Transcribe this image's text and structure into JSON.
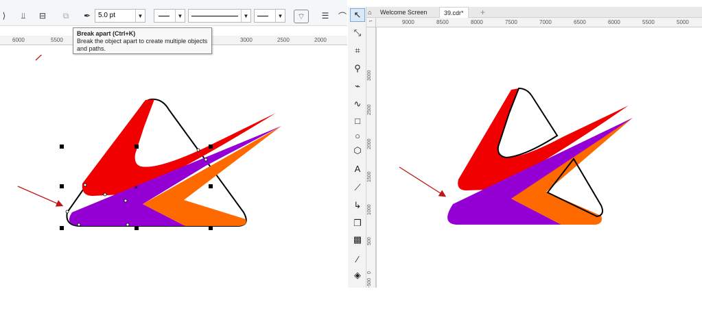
{
  "toolbar": {
    "outline_width": "5.0 pt"
  },
  "tooltip": {
    "title": "Break apart (Ctrl+K)",
    "description": "Break the object apart to create multiple objects and paths."
  },
  "left_ruler": {
    "ticks": [
      "6000",
      "5500",
      "3000",
      "2500",
      "2000"
    ]
  },
  "tabs": {
    "welcome": "Welcome Screen",
    "document": "39.cdr*",
    "add": "+"
  },
  "right_ruler_h": {
    "ticks": [
      "9000",
      "8500",
      "8000",
      "7500",
      "7000",
      "6500",
      "6000",
      "5500",
      "5000"
    ]
  },
  "right_ruler_v": {
    "ticks": [
      "3000",
      "2500",
      "2000",
      "1500",
      "1000",
      "500",
      "0",
      "-500"
    ]
  },
  "colors": {
    "red": "#f00000",
    "purple": "#9400d3",
    "orange": "#ff6a00",
    "arrow": "#c0171b"
  }
}
